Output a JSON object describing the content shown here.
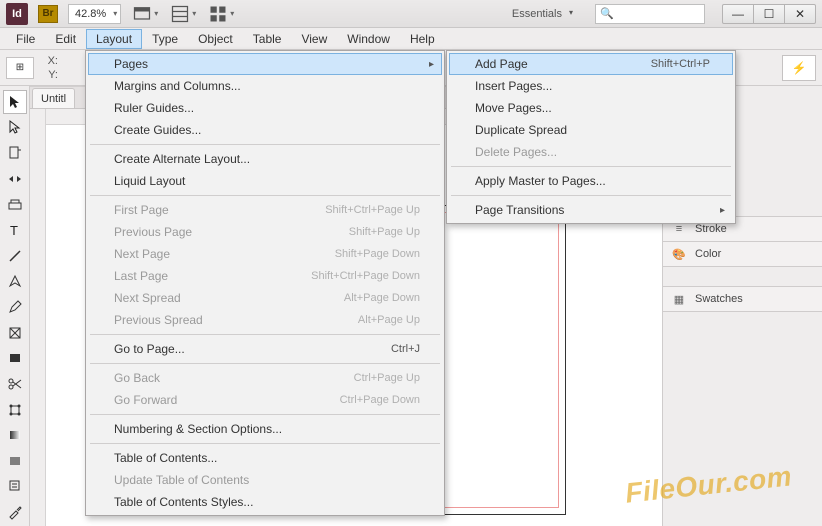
{
  "titlebar": {
    "app_abbrev": "Id",
    "bridge_abbrev": "Br",
    "zoom": "42.8%",
    "workspace_label": "Essentials",
    "search_placeholder": "🔍"
  },
  "menubar": [
    "File",
    "Edit",
    "Layout",
    "Type",
    "Object",
    "Table",
    "View",
    "Window",
    "Help"
  ],
  "coordbar": {
    "x_label": "X:",
    "y_label": "Y:"
  },
  "doc": {
    "tab_title": "Untitl"
  },
  "layout_menu": [
    {
      "label": "Pages",
      "submenu": true,
      "highlight": true
    },
    {
      "label": "Margins and Columns..."
    },
    {
      "label": "Ruler Guides..."
    },
    {
      "label": "Create Guides..."
    },
    {
      "sep": true
    },
    {
      "label": "Create Alternate Layout..."
    },
    {
      "label": "Liquid Layout"
    },
    {
      "sep": true
    },
    {
      "label": "First Page",
      "shortcut": "Shift+Ctrl+Page Up",
      "disabled": true
    },
    {
      "label": "Previous Page",
      "shortcut": "Shift+Page Up",
      "disabled": true
    },
    {
      "label": "Next Page",
      "shortcut": "Shift+Page Down",
      "disabled": true
    },
    {
      "label": "Last Page",
      "shortcut": "Shift+Ctrl+Page Down",
      "disabled": true
    },
    {
      "label": "Next Spread",
      "shortcut": "Alt+Page Down",
      "disabled": true
    },
    {
      "label": "Previous Spread",
      "shortcut": "Alt+Page Up",
      "disabled": true
    },
    {
      "sep": true
    },
    {
      "label": "Go to Page...",
      "shortcut": "Ctrl+J"
    },
    {
      "sep": true
    },
    {
      "label": "Go Back",
      "shortcut": "Ctrl+Page Up",
      "disabled": true
    },
    {
      "label": "Go Forward",
      "shortcut": "Ctrl+Page Down",
      "disabled": true
    },
    {
      "sep": true
    },
    {
      "label": "Numbering & Section Options..."
    },
    {
      "sep": true
    },
    {
      "label": "Table of Contents..."
    },
    {
      "label": "Update Table of Contents",
      "disabled": true
    },
    {
      "label": "Table of Contents Styles..."
    }
  ],
  "pages_submenu": [
    {
      "label": "Add Page",
      "shortcut": "Shift+Ctrl+P",
      "highlight": true
    },
    {
      "label": "Insert Pages..."
    },
    {
      "label": "Move Pages..."
    },
    {
      "label": "Duplicate Spread"
    },
    {
      "label": "Delete Pages...",
      "disabled": true
    },
    {
      "sep": true
    },
    {
      "label": "Apply Master to Pages..."
    },
    {
      "sep": true
    },
    {
      "label": "Page Transitions",
      "submenu": true
    }
  ],
  "panels": {
    "stroke": "Stroke",
    "color": "Color",
    "swatches": "Swatches"
  },
  "watermark": "FileOur.com"
}
